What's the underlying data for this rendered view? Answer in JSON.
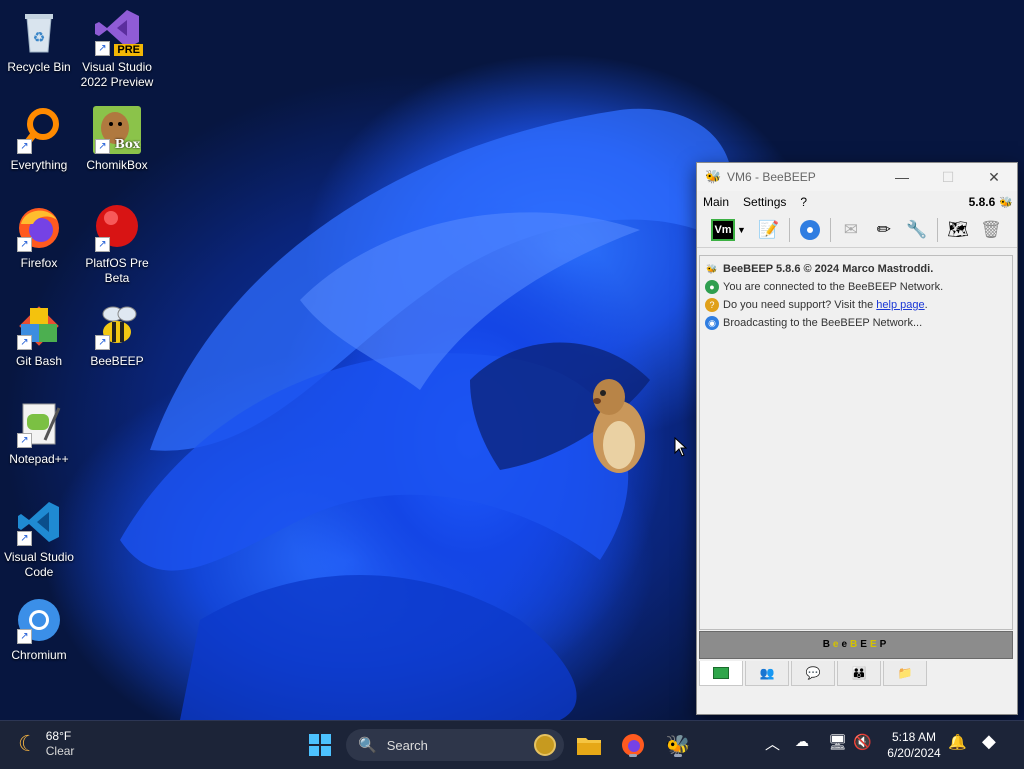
{
  "desktop_icons": [
    {
      "label": "Recycle Bin",
      "icon": "recycle-bin-icon"
    },
    {
      "label": "Visual Studio 2022 Preview",
      "icon": "visual-studio-preview-icon",
      "badge": "PRE"
    },
    {
      "label": "Everything",
      "icon": "everything-search-icon"
    },
    {
      "label": "ChomikBox",
      "icon": "chomikbox-icon",
      "badge": "Box"
    },
    {
      "label": "Firefox",
      "icon": "firefox-icon"
    },
    {
      "label": "PlatfOS Pre Beta",
      "icon": "platfos-icon"
    },
    {
      "label": "Git Bash",
      "icon": "git-bash-icon"
    },
    {
      "label": "BeeBEEP",
      "icon": "beebeep-icon"
    },
    {
      "label": "Notepad++",
      "icon": "notepadpp-icon"
    },
    {
      "label": "Visual Studio Code",
      "icon": "vscode-icon"
    },
    {
      "label": "Chromium",
      "icon": "chromium-icon"
    }
  ],
  "beebeep": {
    "title": "VM6 - BeeBEEP",
    "menu": [
      "Main",
      "Settings",
      "?"
    ],
    "version": "5.8.6",
    "vm_label": "Vm",
    "log": [
      "BeeBEEP 5.8.6 © 2024 Marco Mastroddi.",
      "You are connected to the BeeBEEP Network.",
      "Do you need support? Visit the ",
      "Broadcasting to the BeeBEEP Network..."
    ],
    "help_link": "help page",
    "help_suffix": ".",
    "banner": "BeeBEEP",
    "banner_colors": [
      "#000000",
      "#d4c200",
      "#000000",
      "#d4c200",
      "#000000",
      "#d4c200",
      "#000000"
    ]
  },
  "taskbar": {
    "weather_temp": "68°F",
    "weather_desc": "Clear",
    "search_placeholder": "Search",
    "time": "5:18 AM",
    "date": "6/20/2024"
  },
  "colors": {
    "accent": "#1d5bd6",
    "taskbar": "#1c2438"
  }
}
